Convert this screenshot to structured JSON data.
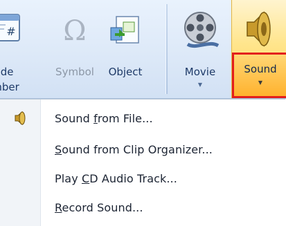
{
  "ribbon": {
    "slide_number": {
      "line1": "ide",
      "line2": "mber"
    },
    "symbol": {
      "label": "Symbol"
    },
    "object": {
      "label": "Object"
    },
    "movie": {
      "label": "Movie"
    },
    "sound": {
      "label": "Sound"
    }
  },
  "menu": {
    "items": [
      {
        "pre": "Sound ",
        "key": "f",
        "post": "rom File...",
        "icon": "speaker-icon"
      },
      {
        "pre": "",
        "key": "S",
        "post": "ound from Clip Organizer...",
        "icon": ""
      },
      {
        "pre": "Play ",
        "key": "C",
        "post": "D Audio Track...",
        "icon": ""
      },
      {
        "pre": "",
        "key": "R",
        "post": "ecord Sound...",
        "icon": ""
      }
    ]
  },
  "colors": {
    "ribbon_bg": "#dde9f8",
    "sound_highlight": "#ffd35a",
    "focus_box": "#e31d1d",
    "menu_gutter": "#f1f4f8"
  }
}
